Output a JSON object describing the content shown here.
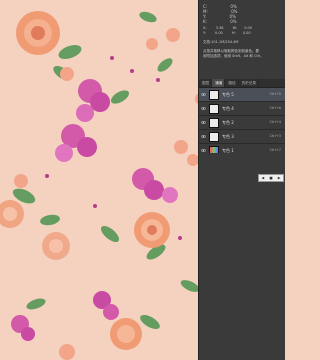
{
  "info": {
    "c_label": "C:",
    "m_label": "M:",
    "y_label": "Y:",
    "k_label": "K:",
    "c_value": "0%",
    "m_value": "0%",
    "y_value": "0%",
    "k_value": "0%",
    "x_label": "X:",
    "y2_label": "Y:",
    "w_label": "W:",
    "h_label": "H:",
    "x_value": "3.38",
    "y_value2": "0.00",
    "w_value": "0.00",
    "h_value": "0.00",
    "doc_line": "文档:101.1M/204.4M",
    "help_line1": "点按并拖移以吸取颜色到前景色。要",
    "help_line2": "用附加选项，使用 Shift、Alt 和 Ctrl。"
  },
  "tabs": [
    "图层",
    "通道",
    "路径",
    "历史记录"
  ],
  "channels": [
    {
      "label": "专色 5",
      "shortcut": "Ctrl+5",
      "selected": true,
      "rgb": false
    },
    {
      "label": "专色 4",
      "shortcut": "Ctrl+6",
      "selected": false,
      "rgb": false
    },
    {
      "label": "专色 2",
      "shortcut": "Ctrl+4",
      "selected": false,
      "rgb": false
    },
    {
      "label": "专色 3",
      "shortcut": "Ctrl+3",
      "selected": false,
      "rgb": false
    },
    {
      "label": "专色 1",
      "shortcut": "Ctrl+7",
      "selected": false,
      "rgb": true
    }
  ],
  "toggle": {
    "left": "◀",
    "mid": "■",
    "right": "▶"
  },
  "colors": {
    "background": "#f4d2bf",
    "panel": "#3a3a3a",
    "leaf": "#5e9a5b",
    "rose": "#e9896e",
    "pink": "#c94aa3"
  }
}
